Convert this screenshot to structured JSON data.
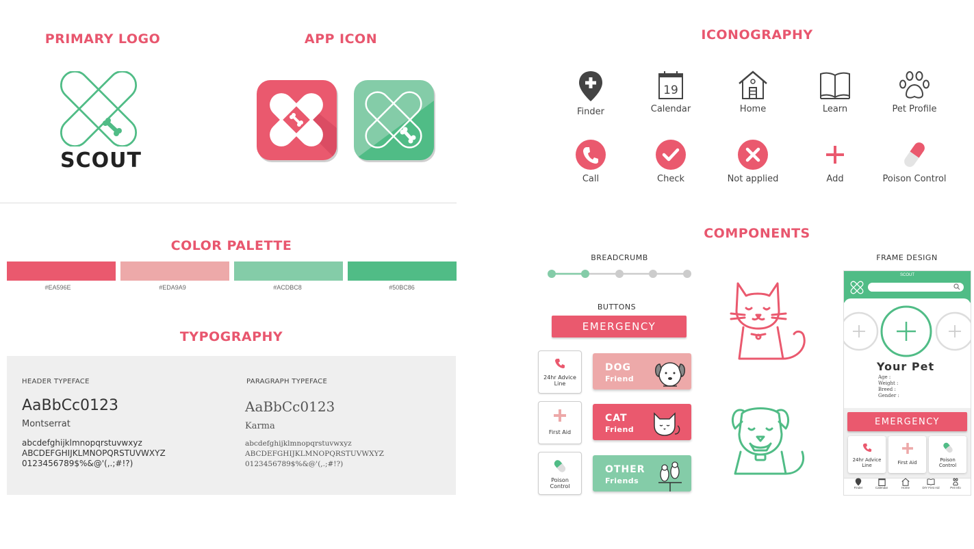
{
  "sections": {
    "primary_logo": "PRIMARY LOGO",
    "app_icon": "APP ICON",
    "color_palette": "COLOR PALETTE",
    "typography": "TYPOGRAPHY",
    "iconography": "ICONOGRAPHY",
    "components": "COMPONENTS"
  },
  "logo": {
    "wordmark": "SCOUT"
  },
  "palette": [
    {
      "hex": "#EA596E",
      "label": "#EA596E"
    },
    {
      "hex": "#EDA9A9",
      "label": "#EDA9A9"
    },
    {
      "hex": "#ACDBC8",
      "label": "#ACDBC8"
    },
    {
      "hex": "#50BC86",
      "label": "#50BC86"
    }
  ],
  "colors": {
    "red": "#EA596E",
    "pink": "#EDA9A9",
    "mint": "#84CCA8",
    "green": "#50BC86",
    "grey_icon": "#444444"
  },
  "typography": {
    "header": {
      "label": "HEADER TYPEFACE",
      "sample": "AaBbCc0123",
      "name": "Montserrat",
      "chars": "abcdefghijklmnopqrstuvwxyz\nABCDEFGHIJKLMNOPQRSTUVWXYZ\n0123456789$%&@'(,.;#!?)"
    },
    "paragraph": {
      "label": "PARAGRAPH TYPEFACE",
      "sample": "AaBbCc0123",
      "name": "Karma",
      "chars": "abcdefghijklmnopqrstuvwxyz\nABCDEFGHIJKLMNOPQRSTUVWXYZ\n0123456789$%&@'(,.;#!?)"
    }
  },
  "icons": {
    "row1": [
      "Finder",
      "Calendar",
      "Home",
      "Learn",
      "Pet Profile"
    ],
    "row2": [
      "Call",
      "Check",
      "Not applied",
      "Add",
      "Poison Control"
    ],
    "calendar_day": "19"
  },
  "components": {
    "breadcrumb_label": "BREADCRUMB",
    "breadcrumb": {
      "steps": 5,
      "completed": 2
    },
    "buttons_label": "BUTTONS",
    "emergency": "EMERGENCY",
    "small_cards": [
      "24hr Advice Line",
      "First Aid",
      "Poison Control"
    ],
    "friends": [
      {
        "title": "DOG",
        "subtitle": "Friend"
      },
      {
        "title": "CAT",
        "subtitle": "Friend"
      },
      {
        "title": "OTHER",
        "subtitle": "Friends"
      }
    ],
    "frame_label": "FRAME DESIGN"
  },
  "frame": {
    "app_name": "SCOUT",
    "pet_title": "Your Pet",
    "fields": [
      "Age :",
      "Weight :",
      "Breed :",
      "Gender :"
    ],
    "emergency": "EMERGENCY",
    "cards": [
      "24hr Advice Line",
      "First Aid",
      "Poison Control"
    ],
    "nav": [
      "Finder",
      "Calendar",
      "Home",
      "DIY First Aid",
      "Pet Info"
    ]
  }
}
